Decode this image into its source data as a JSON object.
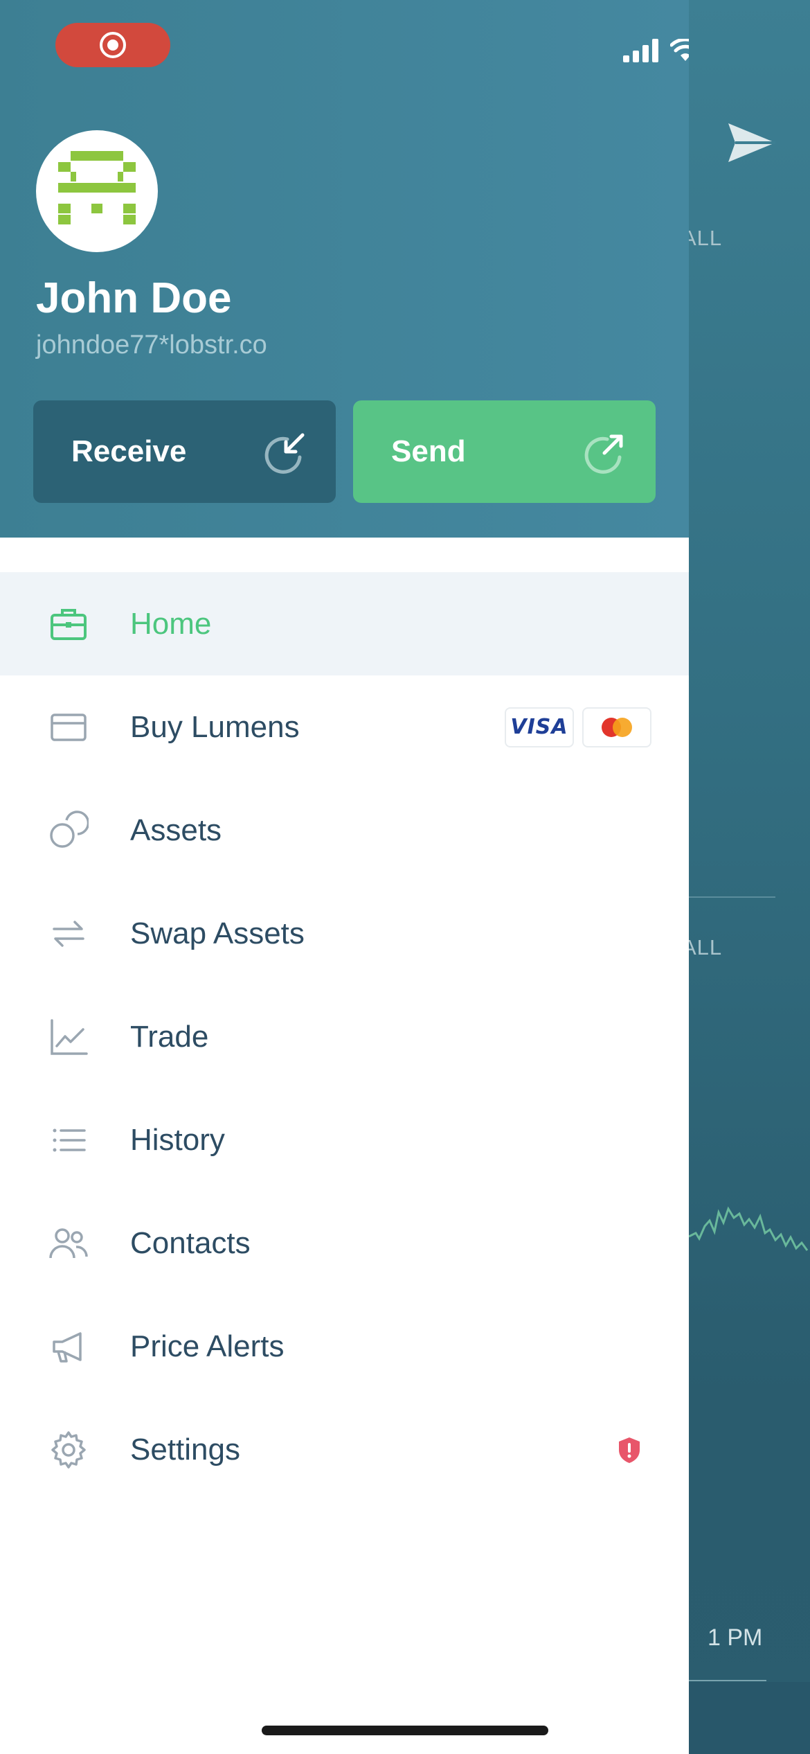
{
  "background_app": {
    "filter_label_1": "ALL",
    "filter_label_2": "ALL",
    "time_label": "1 PM"
  },
  "drawer": {
    "user": {
      "name": "John Doe",
      "address": "johndoe77*lobstr.co"
    },
    "actions": {
      "receive_label": "Receive",
      "send_label": "Send"
    },
    "menu": [
      {
        "label": "Home",
        "icon": "briefcase-icon",
        "active": true
      },
      {
        "label": "Buy Lumens",
        "icon": "credit-card-icon",
        "badges": [
          "VISA",
          "mastercard"
        ]
      },
      {
        "label": "Assets",
        "icon": "coins-icon"
      },
      {
        "label": "Swap Assets",
        "icon": "swap-arrows-icon"
      },
      {
        "label": "Trade",
        "icon": "chart-line-icon"
      },
      {
        "label": "History",
        "icon": "list-icon"
      },
      {
        "label": "Contacts",
        "icon": "users-icon"
      },
      {
        "label": "Price Alerts",
        "icon": "megaphone-icon"
      },
      {
        "label": "Settings",
        "icon": "gear-icon",
        "badge": "security-shield-icon"
      }
    ],
    "visa_text": "VISA"
  },
  "colors": {
    "header": "#4184998",
    "accent_green": "#58c486",
    "receive_dark": "#2c6275",
    "alert_red": "#e8566a"
  }
}
